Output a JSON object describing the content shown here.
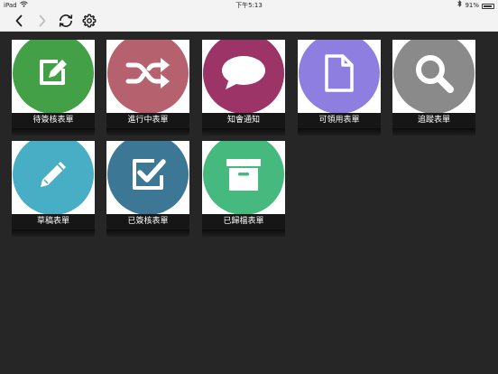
{
  "status_bar": {
    "device": "iPad",
    "time": "下午5:13",
    "battery_percent": "91%",
    "battery_level": 0.91
  },
  "toolbar": {
    "back_icon": "chevron-left-icon",
    "forward_icon": "chevron-right-icon",
    "refresh_icon": "refresh-icon",
    "settings_icon": "gear-icon"
  },
  "tiles": [
    {
      "label": "待簽核表單",
      "icon": "edit-icon",
      "color": "#43a047"
    },
    {
      "label": "進行中表單",
      "icon": "shuffle-icon",
      "color": "#b5616e"
    },
    {
      "label": "知會通知",
      "icon": "speech-bubble-icon",
      "color": "#9c3468"
    },
    {
      "label": "可領用表單",
      "icon": "document-icon",
      "color": "#8e7ee0"
    },
    {
      "label": "追蹤表單",
      "icon": "search-icon",
      "color": "#8a8a8a"
    },
    {
      "label": "草稿表單",
      "icon": "pencil-icon",
      "color": "#47aec6"
    },
    {
      "label": "已簽核表單",
      "icon": "checkbox-icon",
      "color": "#3c7896"
    },
    {
      "label": "已歸檔表單",
      "icon": "archive-icon",
      "color": "#45b97e"
    }
  ]
}
